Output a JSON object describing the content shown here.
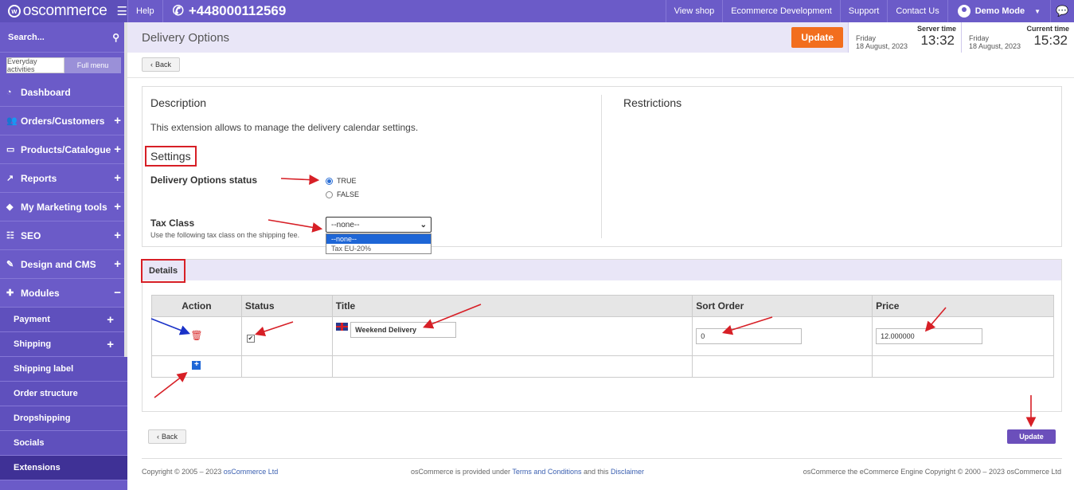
{
  "topbar": {
    "logo": "oscommerce",
    "help": "Help",
    "phone": "+448000112569",
    "links": [
      "View shop",
      "Ecommerce Development",
      "Support",
      "Contact Us"
    ],
    "user": "Demo Mode"
  },
  "sidebar": {
    "search_label": "Search...",
    "toggle_left": "Everyday activities",
    "toggle_right": "Full menu",
    "items": [
      {
        "label": "Dashboard",
        "icon": "dashboard-icon",
        "plus": ""
      },
      {
        "label": "Orders/Customers",
        "icon": "users-icon",
        "plus": "+"
      },
      {
        "label": "Products/Catalogue",
        "icon": "folder-icon",
        "plus": "+"
      },
      {
        "label": "Reports",
        "icon": "chart-icon",
        "plus": "+"
      },
      {
        "label": "My Marketing tools",
        "icon": "tag-icon",
        "plus": "+"
      },
      {
        "label": "SEO",
        "icon": "seo-icon",
        "plus": "+"
      },
      {
        "label": "Design and CMS",
        "icon": "brush-icon",
        "plus": "+"
      },
      {
        "label": "Modules",
        "icon": "puzzle-icon",
        "plus": "−"
      }
    ],
    "subitems": [
      {
        "label": "Payment",
        "plus": "+"
      },
      {
        "label": "Shipping",
        "plus": "+"
      },
      {
        "label": "Shipping label",
        "plus": ""
      },
      {
        "label": "Order structure",
        "plus": ""
      },
      {
        "label": "Dropshipping",
        "plus": ""
      },
      {
        "label": "Socials",
        "plus": ""
      },
      {
        "label": "Extensions",
        "plus": ""
      }
    ]
  },
  "header": {
    "title": "Delivery Options",
    "update": "Update",
    "server_time": {
      "label": "Server time",
      "day": "Friday",
      "date": "18 August, 2023",
      "time": "13:32"
    },
    "current_time": {
      "label": "Current time",
      "day": "Friday",
      "date": "18 August, 2023",
      "time": "15:32"
    }
  },
  "back": "Back",
  "description": {
    "title": "Description",
    "text": "This extension allows to manage the delivery calendar settings."
  },
  "restrictions": {
    "title": "Restrictions"
  },
  "settings": {
    "title": "Settings",
    "status_label": "Delivery Options status",
    "opt_true": "TRUE",
    "opt_false": "FALSE",
    "selected": "TRUE",
    "tax_label": "Tax Class",
    "tax_help": "Use the following tax class on the shipping fee.",
    "tax_value": "--none--",
    "tax_options": [
      "--none--",
      "Tax EU-20%"
    ]
  },
  "details": {
    "title": "Details",
    "columns": [
      "Action",
      "Status",
      "Title",
      "Sort Order",
      "Price"
    ],
    "row": {
      "status_checked": true,
      "title": "Weekend Delivery",
      "sort_order": "0",
      "price": "12.000000"
    }
  },
  "update_button": "Update",
  "footer": {
    "left_prefix": "Copyright © 2005 – 2023 ",
    "left_link": "osCommerce Ltd",
    "mid_prefix": "osCommerce is provided under ",
    "mid_link1": "Terms and Conditions",
    "mid_and": " and this ",
    "mid_link2": "Disclaimer",
    "right": "osCommerce the eCommerce Engine Copyright © 2000 – 2023 osCommerce Ltd"
  },
  "colors": {
    "brand": "#6b5bc8",
    "accent": "#f26e1e",
    "annotation": "#d71f26"
  }
}
